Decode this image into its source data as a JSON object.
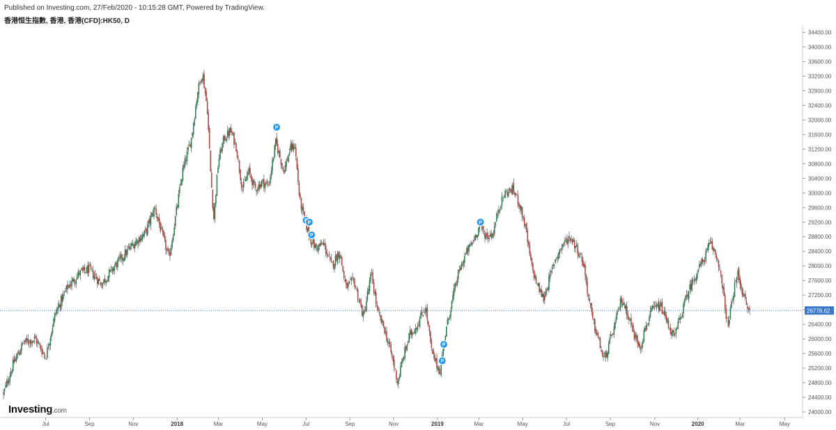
{
  "header": {
    "published": "Published on Investing.com, 27/Feb/2020 - 10:15:28 GMT, Powered by TradingView.",
    "symbol": "香港恒生指數, 香港, 香港(CFD):HK50, D"
  },
  "logo": {
    "name": "Investing",
    "domain": ".com"
  },
  "colors": {
    "up": "#2e7d4f",
    "down": "#b3463f",
    "wick": "#333333",
    "price_line": "#3a78c9",
    "marker": "#2196f3",
    "price_tag_bg": "#3a78c9"
  },
  "chart_data": {
    "type": "candlestick",
    "title": "香港恒生指數, 香港, 香港(CFD):HK50, D",
    "ylim": [
      23900,
      34600
    ],
    "yticks": [
      24000,
      24400,
      24800,
      25200,
      25600,
      26000,
      26400,
      26800,
      27200,
      27600,
      28000,
      28400,
      28800,
      29200,
      29600,
      30000,
      30400,
      30800,
      31200,
      31600,
      32000,
      32400,
      32800,
      33200,
      33600,
      34000,
      34400
    ],
    "ytick_labels": [
      "24000.00",
      "24400.00",
      "24800.00",
      "25200.00",
      "25600.00",
      "26000.00",
      "26400.00",
      "26800.00",
      "27200.00",
      "27600.00",
      "28000.00",
      "28400.00",
      "28800.00",
      "29200.00",
      "29600.00",
      "30000.00",
      "30400.00",
      "30800.00",
      "31200.00",
      "31600.00",
      "32000.00",
      "32400.00",
      "32800.00",
      "33200.00",
      "33600.00",
      "34000.00",
      "34400.00"
    ],
    "xticks": [
      {
        "label": "Jul",
        "t": 0.053,
        "bold": false
      },
      {
        "label": "Sep",
        "t": 0.108,
        "bold": false
      },
      {
        "label": "Nov",
        "t": 0.163,
        "bold": false
      },
      {
        "label": "2018",
        "t": 0.218,
        "bold": true
      },
      {
        "label": "Mar",
        "t": 0.27,
        "bold": false
      },
      {
        "label": "May",
        "t": 0.325,
        "bold": false
      },
      {
        "label": "Jul",
        "t": 0.38,
        "bold": false
      },
      {
        "label": "Sep",
        "t": 0.435,
        "bold": false
      },
      {
        "label": "Nov",
        "t": 0.49,
        "bold": false
      },
      {
        "label": "2019",
        "t": 0.545,
        "bold": true
      },
      {
        "label": "Mar",
        "t": 0.597,
        "bold": false
      },
      {
        "label": "May",
        "t": 0.652,
        "bold": false
      },
      {
        "label": "Jul",
        "t": 0.707,
        "bold": false
      },
      {
        "label": "Sep",
        "t": 0.762,
        "bold": false
      },
      {
        "label": "Nov",
        "t": 0.818,
        "bold": false
      },
      {
        "label": "2020",
        "t": 0.872,
        "bold": true
      },
      {
        "label": "Mar",
        "t": 0.925,
        "bold": false
      },
      {
        "label": "May",
        "t": 0.981,
        "bold": false
      }
    ],
    "last_price": 26778.62,
    "last_price_label": "26778.62",
    "markers": [
      {
        "t": 0.343,
        "price": 31800
      },
      {
        "t": 0.38,
        "price": 29250
      },
      {
        "t": 0.384,
        "price": 29200
      },
      {
        "t": 0.387,
        "price": 28850
      },
      {
        "t": 0.553,
        "price": 25850
      },
      {
        "t": 0.551,
        "price": 25400
      },
      {
        "t": 0.599,
        "price": 29200
      }
    ],
    "marker_label": "P",
    "anchors": [
      [
        0.0,
        24500
      ],
      [
        0.012,
        25300
      ],
      [
        0.025,
        25900
      ],
      [
        0.04,
        26000
      ],
      [
        0.053,
        25500
      ],
      [
        0.065,
        26700
      ],
      [
        0.08,
        27400
      ],
      [
        0.095,
        27800
      ],
      [
        0.108,
        27900
      ],
      [
        0.123,
        27500
      ],
      [
        0.14,
        28000
      ],
      [
        0.155,
        28400
      ],
      [
        0.163,
        28600
      ],
      [
        0.178,
        28900
      ],
      [
        0.19,
        29600
      ],
      [
        0.2,
        28800
      ],
      [
        0.208,
        28200
      ],
      [
        0.215,
        29200
      ],
      [
        0.225,
        30600
      ],
      [
        0.236,
        31500
      ],
      [
        0.244,
        32800
      ],
      [
        0.25,
        33300
      ],
      [
        0.256,
        32300
      ],
      [
        0.26,
        30600
      ],
      [
        0.264,
        29300
      ],
      [
        0.27,
        30900
      ],
      [
        0.277,
        31500
      ],
      [
        0.285,
        31700
      ],
      [
        0.292,
        31300
      ],
      [
        0.3,
        30100
      ],
      [
        0.308,
        30600
      ],
      [
        0.316,
        30100
      ],
      [
        0.325,
        30300
      ],
      [
        0.333,
        30200
      ],
      [
        0.342,
        31400
      ],
      [
        0.352,
        30600
      ],
      [
        0.36,
        31200
      ],
      [
        0.366,
        31300
      ],
      [
        0.372,
        29800
      ],
      [
        0.378,
        29300
      ],
      [
        0.384,
        28800
      ],
      [
        0.392,
        28500
      ],
      [
        0.402,
        28600
      ],
      [
        0.412,
        28000
      ],
      [
        0.422,
        28400
      ],
      [
        0.43,
        27400
      ],
      [
        0.44,
        27600
      ],
      [
        0.452,
        26600
      ],
      [
        0.462,
        27800
      ],
      [
        0.47,
        26700
      ],
      [
        0.478,
        26300
      ],
      [
        0.487,
        25600
      ],
      [
        0.495,
        24800
      ],
      [
        0.502,
        25500
      ],
      [
        0.51,
        26100
      ],
      [
        0.52,
        26400
      ],
      [
        0.53,
        26900
      ],
      [
        0.538,
        25600
      ],
      [
        0.548,
        25100
      ],
      [
        0.553,
        25900
      ],
      [
        0.56,
        26700
      ],
      [
        0.57,
        27700
      ],
      [
        0.58,
        28300
      ],
      [
        0.59,
        28700
      ],
      [
        0.598,
        29100
      ],
      [
        0.607,
        28800
      ],
      [
        0.615,
        28900
      ],
      [
        0.622,
        29600
      ],
      [
        0.63,
        30000
      ],
      [
        0.64,
        30100
      ],
      [
        0.648,
        29700
      ],
      [
        0.655,
        29100
      ],
      [
        0.663,
        28000
      ],
      [
        0.67,
        27500
      ],
      [
        0.678,
        27100
      ],
      [
        0.685,
        27600
      ],
      [
        0.693,
        28200
      ],
      [
        0.703,
        28600
      ],
      [
        0.712,
        28800
      ],
      [
        0.72,
        28500
      ],
      [
        0.728,
        28100
      ],
      [
        0.735,
        27100
      ],
      [
        0.74,
        26500
      ],
      [
        0.747,
        26000
      ],
      [
        0.754,
        25400
      ],
      [
        0.76,
        25800
      ],
      [
        0.768,
        26400
      ],
      [
        0.776,
        27100
      ],
      [
        0.784,
        26700
      ],
      [
        0.792,
        26100
      ],
      [
        0.8,
        25800
      ],
      [
        0.806,
        26300
      ],
      [
        0.815,
        26800
      ],
      [
        0.825,
        26900
      ],
      [
        0.835,
        26400
      ],
      [
        0.842,
        26000
      ],
      [
        0.85,
        26600
      ],
      [
        0.86,
        27300
      ],
      [
        0.87,
        27800
      ],
      [
        0.88,
        28200
      ],
      [
        0.887,
        28600
      ],
      [
        0.893,
        28400
      ],
      [
        0.898,
        28100
      ],
      [
        0.904,
        27200
      ],
      [
        0.91,
        26300
      ],
      [
        0.916,
        27200
      ],
      [
        0.922,
        27800
      ],
      [
        0.928,
        27300
      ],
      [
        0.933,
        26900
      ],
      [
        0.937,
        26750
      ]
    ]
  }
}
